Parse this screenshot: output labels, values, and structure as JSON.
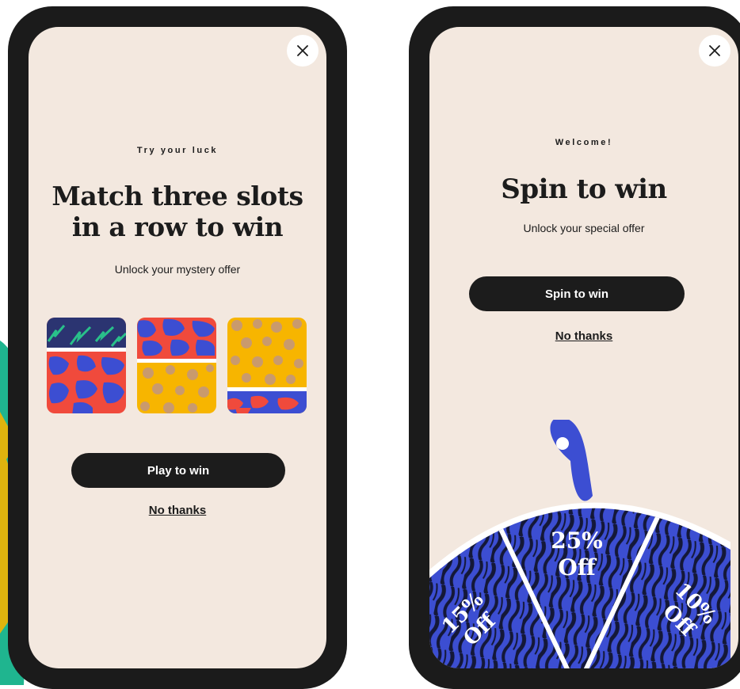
{
  "left_popup": {
    "eyebrow": "Try your luck",
    "headline_line1": "Match three slots",
    "headline_line2": "in a row to win",
    "subtitle": "Unlock your mystery offer",
    "cta_label": "Play to win",
    "dismiss_label": "No thanks",
    "close_icon": "close-icon"
  },
  "right_popup": {
    "eyebrow": "Welcome!",
    "headline": "Spin to win",
    "subtitle": "Unlock your special offer",
    "cta_label": "Spin to win",
    "dismiss_label": "No thanks",
    "close_icon": "close-icon",
    "wheel_segments": [
      {
        "amount": "15%",
        "label": "Off"
      },
      {
        "amount": "25%",
        "label": "Off"
      },
      {
        "amount": "10%",
        "label": "Off"
      }
    ]
  },
  "colors": {
    "cream": "#f3e8df",
    "dark": "#1c1c1c",
    "blue": "#3c4ed2",
    "navy": "#2b3471",
    "red": "#f04a3c",
    "yellow": "#f7b500",
    "tan": "#c99a6d",
    "green": "#29c08a"
  }
}
